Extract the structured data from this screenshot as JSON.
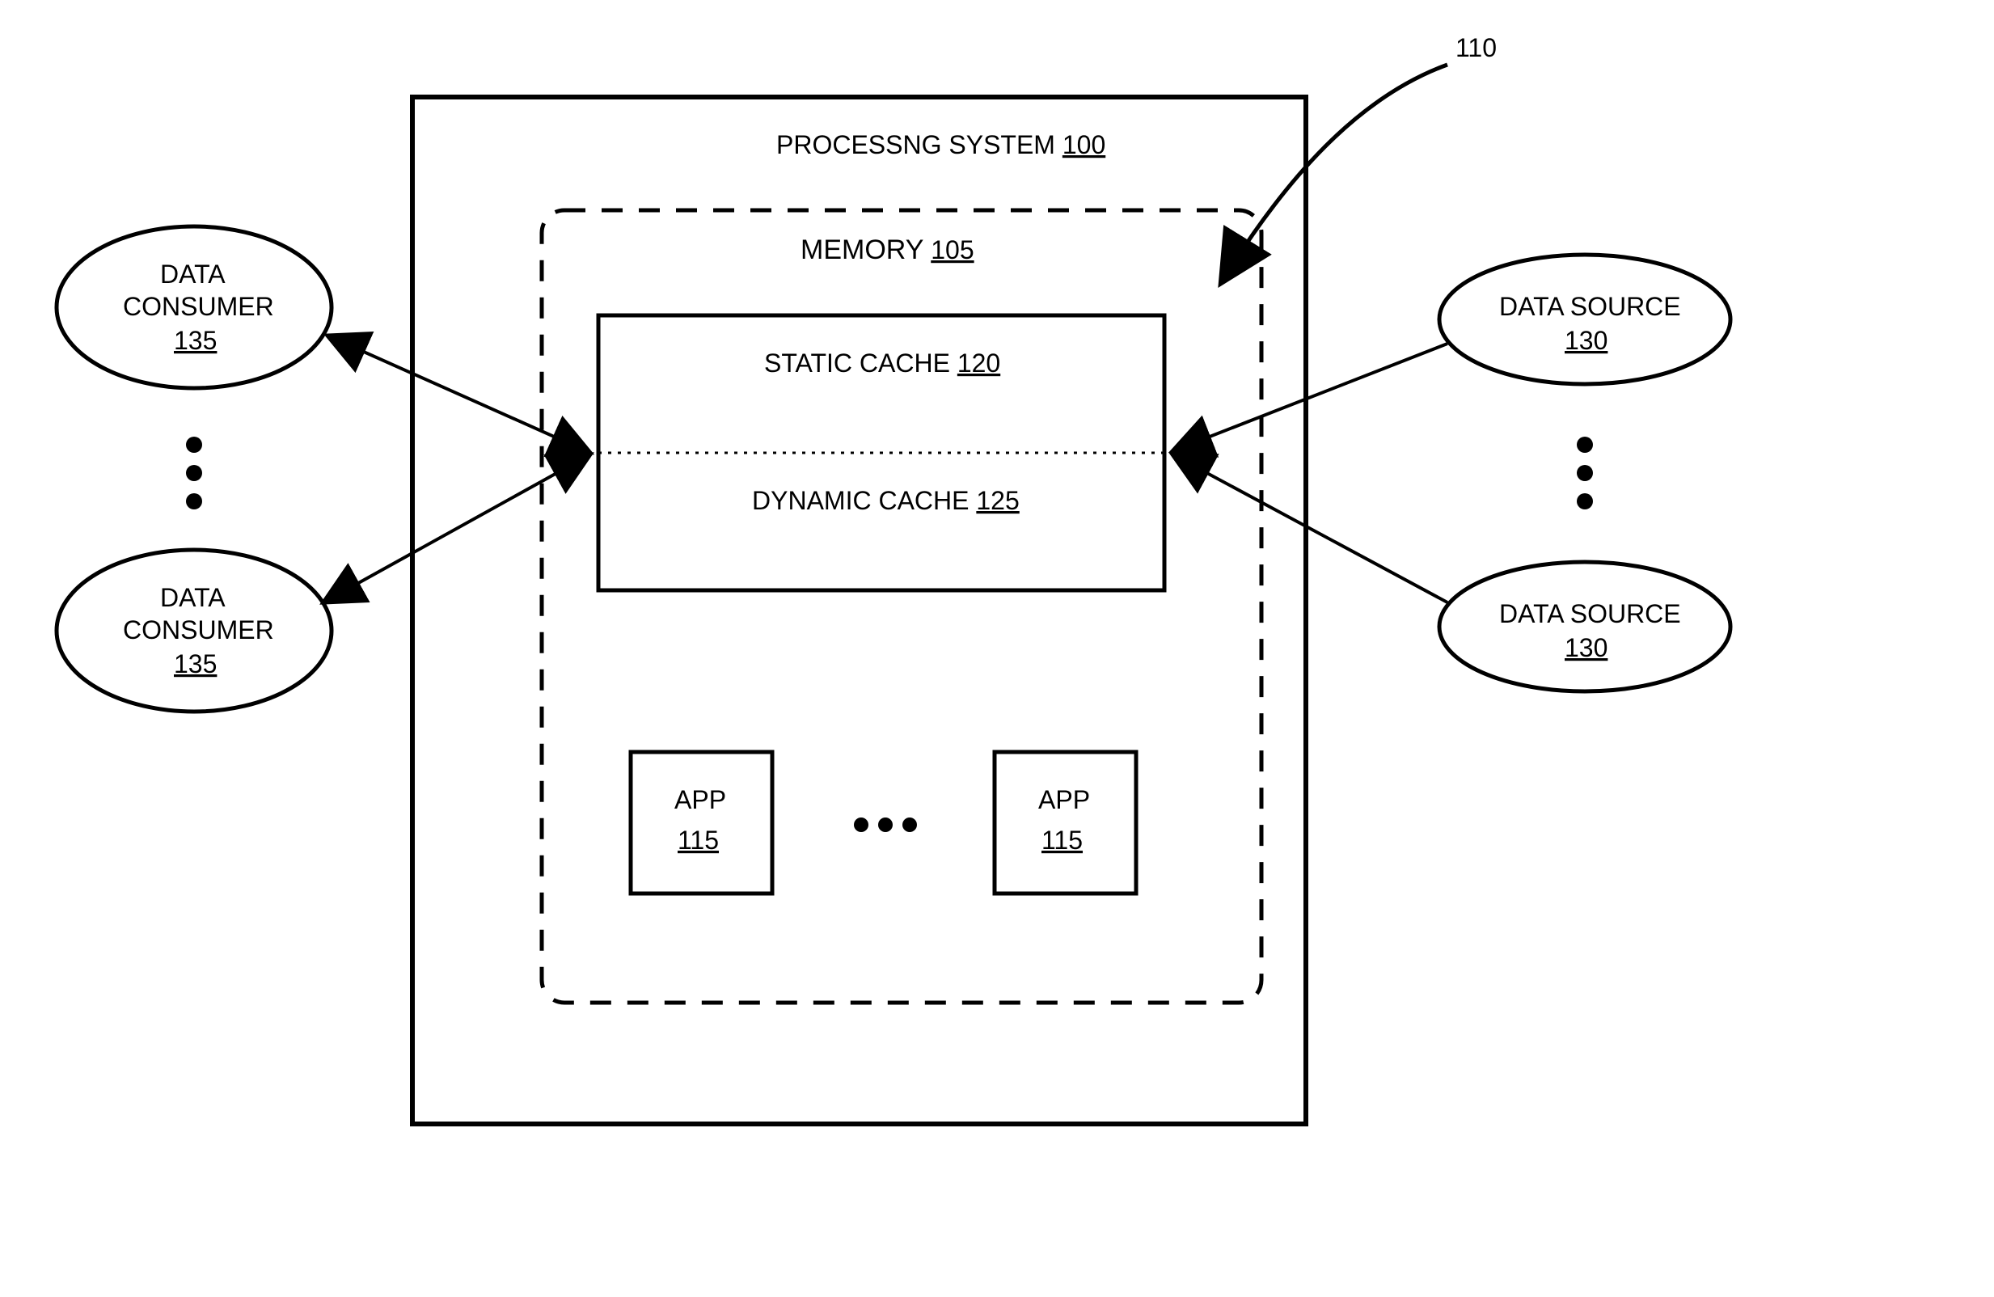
{
  "processing_system": {
    "label": "PROCESSNG SYSTEM",
    "ref": "100"
  },
  "memory": {
    "label": "MEMORY",
    "ref": "105"
  },
  "callout": {
    "ref": "110"
  },
  "static_cache": {
    "label": "STATIC CACHE",
    "ref": "120"
  },
  "dynamic_cache": {
    "label": "DYNAMIC CACHE",
    "ref": "125"
  },
  "app": {
    "label": "APP",
    "ref": "115"
  },
  "data_consumer": {
    "label_line1": "DATA",
    "label_line2": "CONSUMER",
    "ref": "135"
  },
  "data_source": {
    "label": "DATA SOURCE",
    "ref": "130"
  },
  "ellipsis_v": "⋮",
  "ellipsis_h": "•••"
}
